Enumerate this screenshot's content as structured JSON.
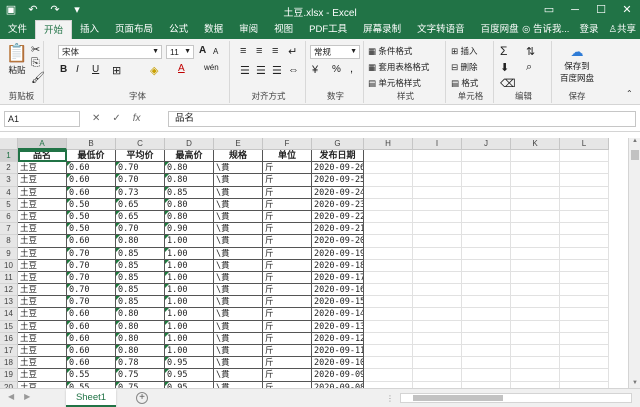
{
  "window": {
    "title": "土豆.xlsx - Excel",
    "qat_icons": [
      "save-icon",
      "undo-icon",
      "redo-icon",
      "customize-icon"
    ],
    "buttons": [
      "ribbon-options-icon",
      "minimize-icon",
      "maximize-icon",
      "close-icon"
    ]
  },
  "tabs": [
    "文件",
    "开始",
    "插入",
    "页面布局",
    "公式",
    "数据",
    "审阅",
    "视图",
    "PDF工具",
    "屏幕录制",
    "文字转语音",
    "百度网盘"
  ],
  "active_tab": "开始",
  "tab_right": {
    "tell_me": "告诉我...",
    "login": "登录",
    "share": "共享"
  },
  "ribbon": {
    "clipboard": {
      "label": "剪贴板",
      "paste": "粘贴"
    },
    "font": {
      "label": "字体",
      "name": "宋体",
      "size": "11",
      "bold": "B",
      "italic": "I",
      "underline": "U",
      "grow": "A",
      "shrink": "A",
      "fontcolor": "A",
      "wen": "wén"
    },
    "align": {
      "label": "对齐方式"
    },
    "number": {
      "label": "数字",
      "format": "常规",
      "percent": "%",
      "comma": ","
    },
    "styles": {
      "label": "样式",
      "cond": "条件格式",
      "table": "套用表格格式",
      "cell": "单元格样式"
    },
    "cells": {
      "label": "单元格",
      "insert": "插入",
      "delete": "删除",
      "format": "格式"
    },
    "edit": {
      "label": "编辑",
      "sigma": "Σ"
    },
    "save": {
      "label": "保存",
      "line1": "保存到",
      "line2": "百度网盘"
    }
  },
  "formula_bar": {
    "name_box": "A1",
    "cancel": "✕",
    "confirm": "✓",
    "fx": "fx",
    "content": "品名"
  },
  "columns": [
    "A",
    "B",
    "C",
    "D",
    "E",
    "F",
    "G",
    "H",
    "I",
    "J",
    "K",
    "L"
  ],
  "headers": [
    "品名",
    "最低价",
    "平均价",
    "最高价",
    "规格",
    "单位",
    "发布日期"
  ],
  "rows": [
    [
      "土豆",
      "0.60",
      "0.70",
      "0.80",
      "\\貫",
      "斤",
      "2020-09-26"
    ],
    [
      "土豆",
      "0.60",
      "0.70",
      "0.80",
      "\\貫",
      "斤",
      "2020-09-25"
    ],
    [
      "土豆",
      "0.60",
      "0.73",
      "0.85",
      "\\貫",
      "斤",
      "2020-09-24"
    ],
    [
      "土豆",
      "0.50",
      "0.65",
      "0.80",
      "\\貫",
      "斤",
      "2020-09-23"
    ],
    [
      "土豆",
      "0.50",
      "0.65",
      "0.80",
      "\\貫",
      "斤",
      "2020-09-22"
    ],
    [
      "土豆",
      "0.50",
      "0.70",
      "0.90",
      "\\貫",
      "斤",
      "2020-09-21"
    ],
    [
      "土豆",
      "0.60",
      "0.80",
      "1.00",
      "\\貫",
      "斤",
      "2020-09-20"
    ],
    [
      "土豆",
      "0.70",
      "0.85",
      "1.00",
      "\\貫",
      "斤",
      "2020-09-19"
    ],
    [
      "土豆",
      "0.70",
      "0.85",
      "1.00",
      "\\貫",
      "斤",
      "2020-09-18"
    ],
    [
      "土豆",
      "0.70",
      "0.85",
      "1.00",
      "\\貫",
      "斤",
      "2020-09-17"
    ],
    [
      "土豆",
      "0.70",
      "0.85",
      "1.00",
      "\\貫",
      "斤",
      "2020-09-16"
    ],
    [
      "土豆",
      "0.70",
      "0.85",
      "1.00",
      "\\貫",
      "斤",
      "2020-09-15"
    ],
    [
      "土豆",
      "0.60",
      "0.80",
      "1.00",
      "\\貫",
      "斤",
      "2020-09-14"
    ],
    [
      "土豆",
      "0.60",
      "0.80",
      "1.00",
      "\\貫",
      "斤",
      "2020-09-13"
    ],
    [
      "土豆",
      "0.60",
      "0.80",
      "1.00",
      "\\貫",
      "斤",
      "2020-09-12"
    ],
    [
      "土豆",
      "0.60",
      "0.80",
      "1.00",
      "\\貫",
      "斤",
      "2020-09-11"
    ],
    [
      "土豆",
      "0.60",
      "0.78",
      "0.95",
      "\\貫",
      "斤",
      "2020-09-10"
    ],
    [
      "土豆",
      "0.55",
      "0.75",
      "0.95",
      "\\貫",
      "斤",
      "2020-09-09"
    ],
    [
      "土豆",
      "0.55",
      "0.75",
      "0.95",
      "\\貫",
      "斤",
      "2020-09-08"
    ]
  ],
  "sheet_tab": "Sheet1",
  "add_sheet": "+",
  "colors": {
    "excel_green": "#217346",
    "ribbon_bg": "#f3f3f3"
  }
}
